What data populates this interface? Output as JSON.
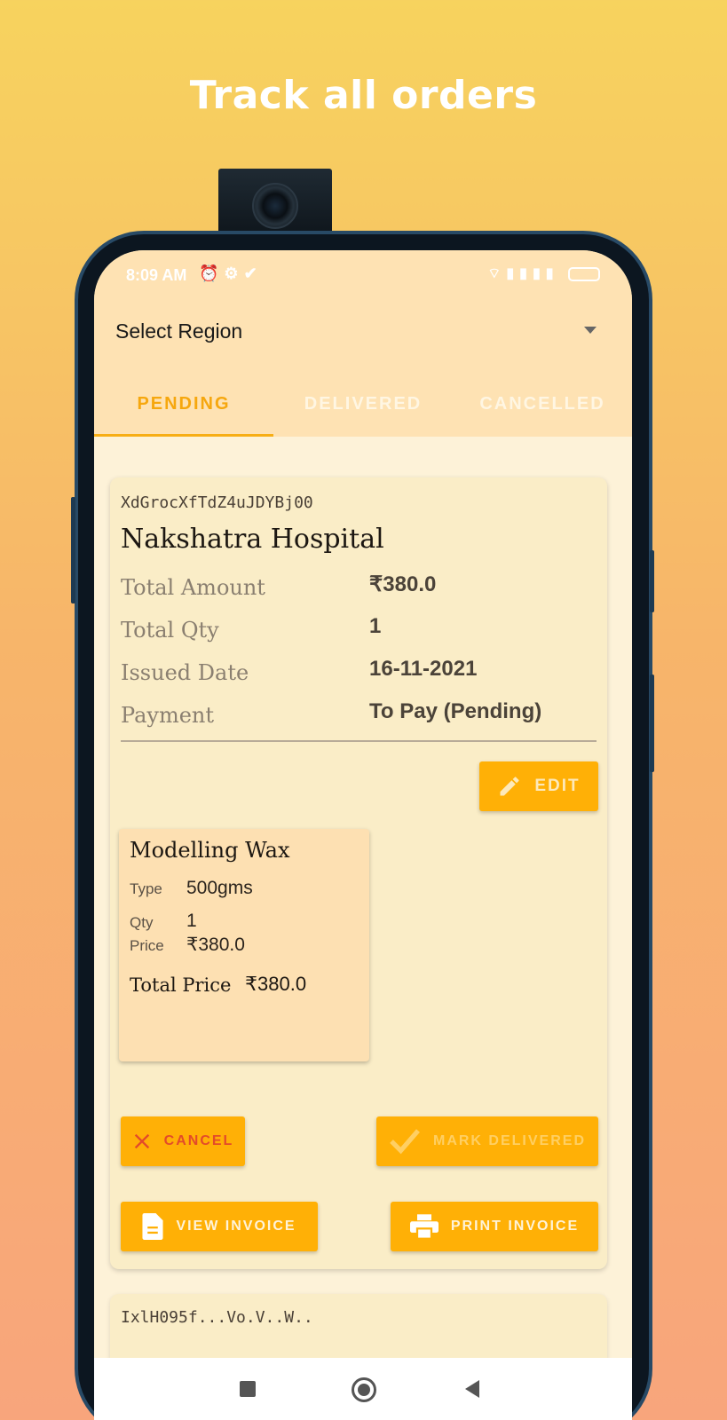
{
  "headline": "Track all orders",
  "status_bar": {
    "time": "8:09 AM",
    "icons_left": [
      "alarm-icon",
      "settings-icon",
      "check-icon"
    ],
    "icons_right": [
      "wifi-icon",
      "signal-icon",
      "signal-icon",
      "battery-icon"
    ]
  },
  "region_select": {
    "label": "Select Region"
  },
  "tabs": [
    {
      "label": "PENDING",
      "active": true
    },
    {
      "label": "DELIVERED",
      "active": false
    },
    {
      "label": "CANCELLED",
      "active": false
    }
  ],
  "order": {
    "id": "XdGrocXfTdZ4uJDYBj00",
    "customer": "Nakshatra Hospital",
    "fields": [
      {
        "label": "Total Amount",
        "value": "₹380.0"
      },
      {
        "label": "Total Qty",
        "value": "1"
      },
      {
        "label": "Issued Date",
        "value": "16-11-2021"
      },
      {
        "label": "Payment",
        "value": "To Pay (Pending)"
      }
    ],
    "edit_label": "EDIT",
    "item": {
      "name": "Modelling Wax",
      "type_label": "Type",
      "type_value": "500gms",
      "qty_label": "Qty",
      "qty_value": "1",
      "price_label": "Price",
      "price_value": "₹380.0",
      "total_label": "Total Price",
      "total_value": "₹380.0"
    },
    "actions": {
      "cancel": "CANCEL",
      "mark_delivered": "MARK DELIVERED",
      "view_invoice": "VIEW INVOICE",
      "print_invoice": "PRINT INVOICE"
    }
  },
  "next_order_peek": "IxlH095f...Vo.V..W..",
  "colors": {
    "accent": "#ffb006",
    "active_tab": "#f6a70e",
    "cancel_text": "#e34a2a",
    "card_bg": "#faedc7",
    "item_bg": "#fde0b2"
  }
}
